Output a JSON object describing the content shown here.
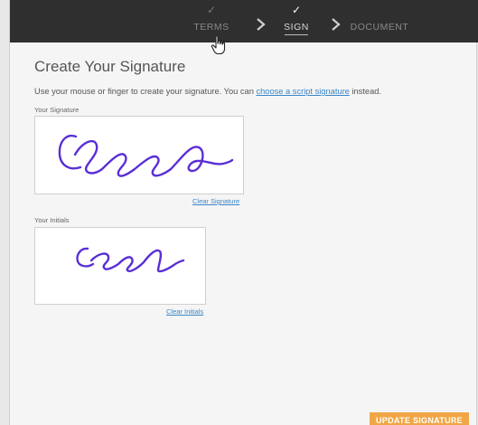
{
  "steps": [
    {
      "label": "TERMS",
      "check": "✓"
    },
    {
      "label": "SIGN",
      "check": "✓"
    },
    {
      "label": "DOCUMENT",
      "check": ""
    }
  ],
  "page": {
    "title": "Create Your Signature",
    "instruction_prefix": "Use your mouse or finger to create your signature. You can ",
    "instruction_link": "choose a script signature",
    "instruction_suffix": " instead."
  },
  "signature": {
    "label": "Your Signature",
    "clear_label": "Clear Signature"
  },
  "initials": {
    "label": "Your Initials",
    "clear_label": "Clear Initials"
  },
  "update_button": "UPDATE SIGNATURE",
  "colors": {
    "topbar": "#2f2f2f",
    "ink": "#5a2fd6",
    "link": "#3a86c8",
    "button": "#f0a645"
  }
}
